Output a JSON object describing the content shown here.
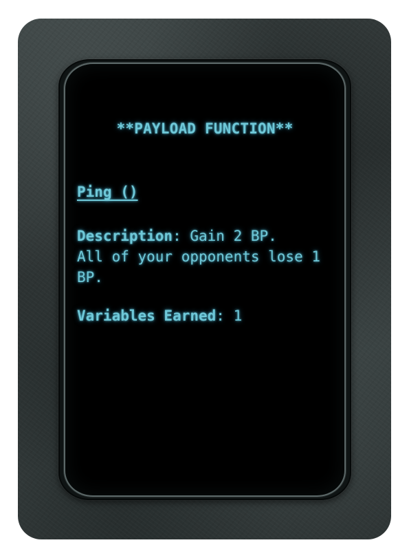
{
  "card": {
    "title": "**PAYLOAD FUNCTION**",
    "function_name": "Ping ()",
    "description_label": "Description",
    "description_separator": ":",
    "description_line1": " Gain 2 BP.",
    "description_line2": "All of your opponents lose 1 BP.",
    "variables_label": "Variables Earned",
    "variables_separator": ":",
    "variables_value": " 1"
  },
  "colors": {
    "text_glow": "#6fc8d8",
    "screen_background": "#000000",
    "card_frame": "#2f3636"
  }
}
